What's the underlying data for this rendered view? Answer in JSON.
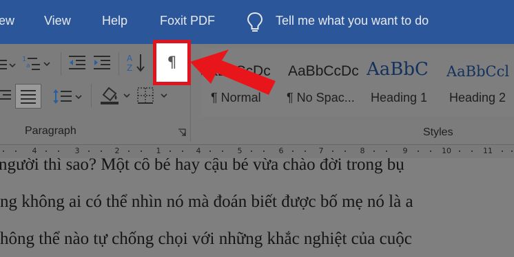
{
  "menu": {
    "tabs": [
      "ew",
      "View",
      "Help",
      "Foxit PDF"
    ],
    "tell_me": "Tell me what you want to do"
  },
  "ribbon": {
    "paragraph_group_label": "Paragraph",
    "styles_group_label": "Styles",
    "show_hide_symbol": "¶",
    "styles": [
      {
        "sample": "AaBbCcDc",
        "name": "¶ Normal"
      },
      {
        "sample": "AaBbCcDc",
        "name": "¶ No Spac..."
      },
      {
        "sample": "AaBbC",
        "name": "Heading 1"
      },
      {
        "sample": "AaBbCcl",
        "name": "Heading 2"
      }
    ]
  },
  "ruler": {
    "labels": [
      "4",
      "3",
      "2",
      "1",
      "1",
      "2",
      "3",
      "4",
      "5",
      "6",
      "7",
      "8",
      "9",
      "10",
      "11",
      "12",
      "13",
      "14",
      "15",
      "16",
      "17",
      "18",
      "19",
      "20"
    ]
  },
  "document": {
    "lines": [
      "người thì sao? Một cô bé hay cậu bé vừa chào đời trong bụ",
      "ng không ai có thể nhìn nó mà đoán biết được bố mẹ nó là a",
      "hông thể nào tự chống chọi với những khắc nghiệt của cuộc"
    ]
  },
  "colors": {
    "title_bar": "#2b579a",
    "highlight_box": "#e0141f",
    "arrow": "#e8161b"
  },
  "icons": [
    "lightbulb-icon",
    "bullets-icon",
    "multilevel-list-icon",
    "decrease-indent-icon",
    "increase-indent-icon",
    "sort-icon",
    "show-hide-formatting-icon",
    "justify-icon",
    "line-spacing-icon",
    "shading-icon",
    "borders-icon",
    "dialog-launcher-icon"
  ]
}
